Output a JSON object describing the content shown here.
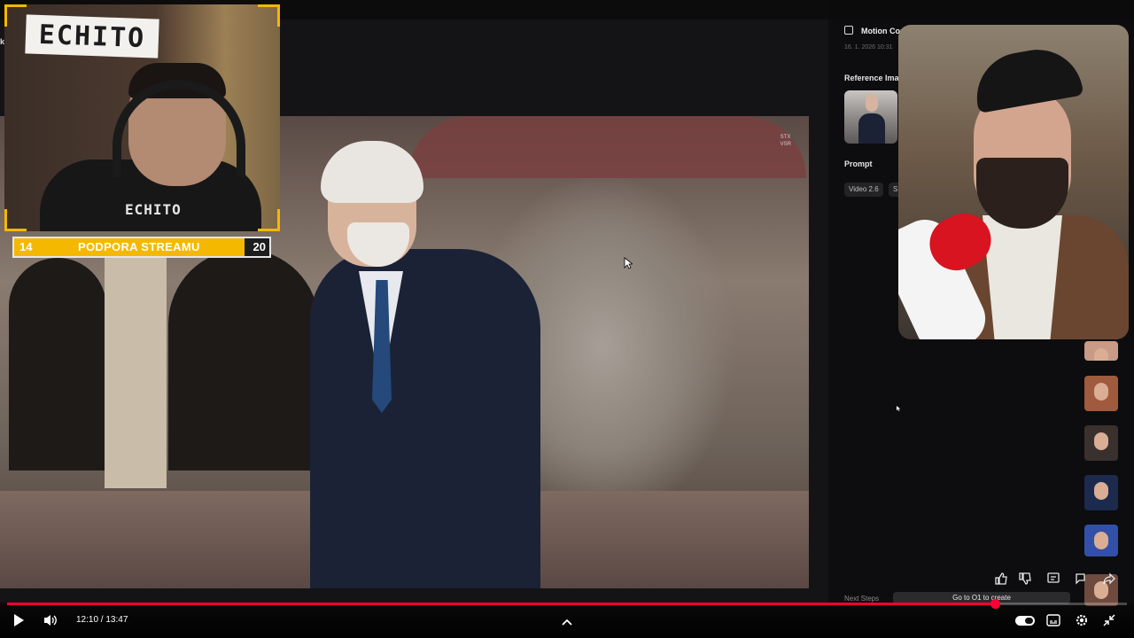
{
  "webcam": {
    "sign_text": "ECHITO",
    "shirt_text": "ECHITO"
  },
  "goal": {
    "start": "14",
    "title": "PODPORA STREAMU",
    "end": "20"
  },
  "stray_text": "k",
  "video": {
    "watermark_line1": "STX",
    "watermark_line2": "VSR"
  },
  "panel": {
    "title": "Motion Con",
    "date": "16. 1. 2026 10:31",
    "reference_label": "Reference Imag",
    "prompt_label": "Prompt",
    "chip_model": "Video 2.6",
    "chip_s": "S",
    "next_steps": "Next Steps",
    "go_button": "Go to O1 to create"
  },
  "actions": {
    "like": "like-icon",
    "dislike": "dislike-icon",
    "comment": "comment-icon",
    "chat": "chat-icon",
    "share": "share-icon"
  },
  "player": {
    "time": "12:10 / 13:47",
    "progress": 0.882,
    "accent": "#ff0033"
  },
  "colors": {
    "goal_bar": "#f5b800",
    "background": "#0b0b0c"
  }
}
